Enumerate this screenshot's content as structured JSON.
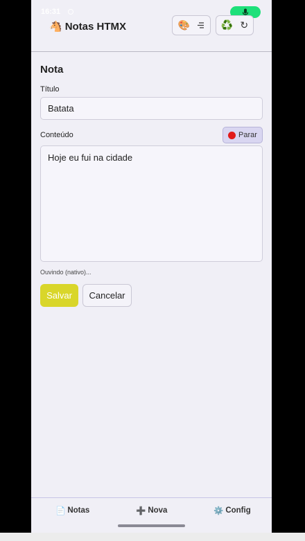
{
  "status_bar": {
    "time": "16:31"
  },
  "header": {
    "logo_glyph": "🐴",
    "title": "Notas HTMX",
    "theme_glyph": "🎨",
    "recycle_glyph": "♻️",
    "refresh_glyph": "↻"
  },
  "form": {
    "section_title": "Nota",
    "title_label": "Título",
    "title_value": "Batata",
    "content_label": "Conteúdo",
    "stop_label": "Parar",
    "content_value": "Hoje eu fui na cidade",
    "listening_status": "Ouvindo (nativo)...",
    "save_label": "Salvar",
    "cancel_label": "Cancelar"
  },
  "bottom_nav": {
    "items": [
      {
        "glyph": "📄",
        "label": "Notas"
      },
      {
        "glyph": "➕",
        "label": "Nova"
      },
      {
        "glyph": "⚙️",
        "label": "Config"
      }
    ]
  },
  "colors": {
    "mic_pill": "#1ee07a",
    "save_button": "#d9d62a",
    "stop_dot": "#e11a1a",
    "background": "#f0eff6"
  }
}
